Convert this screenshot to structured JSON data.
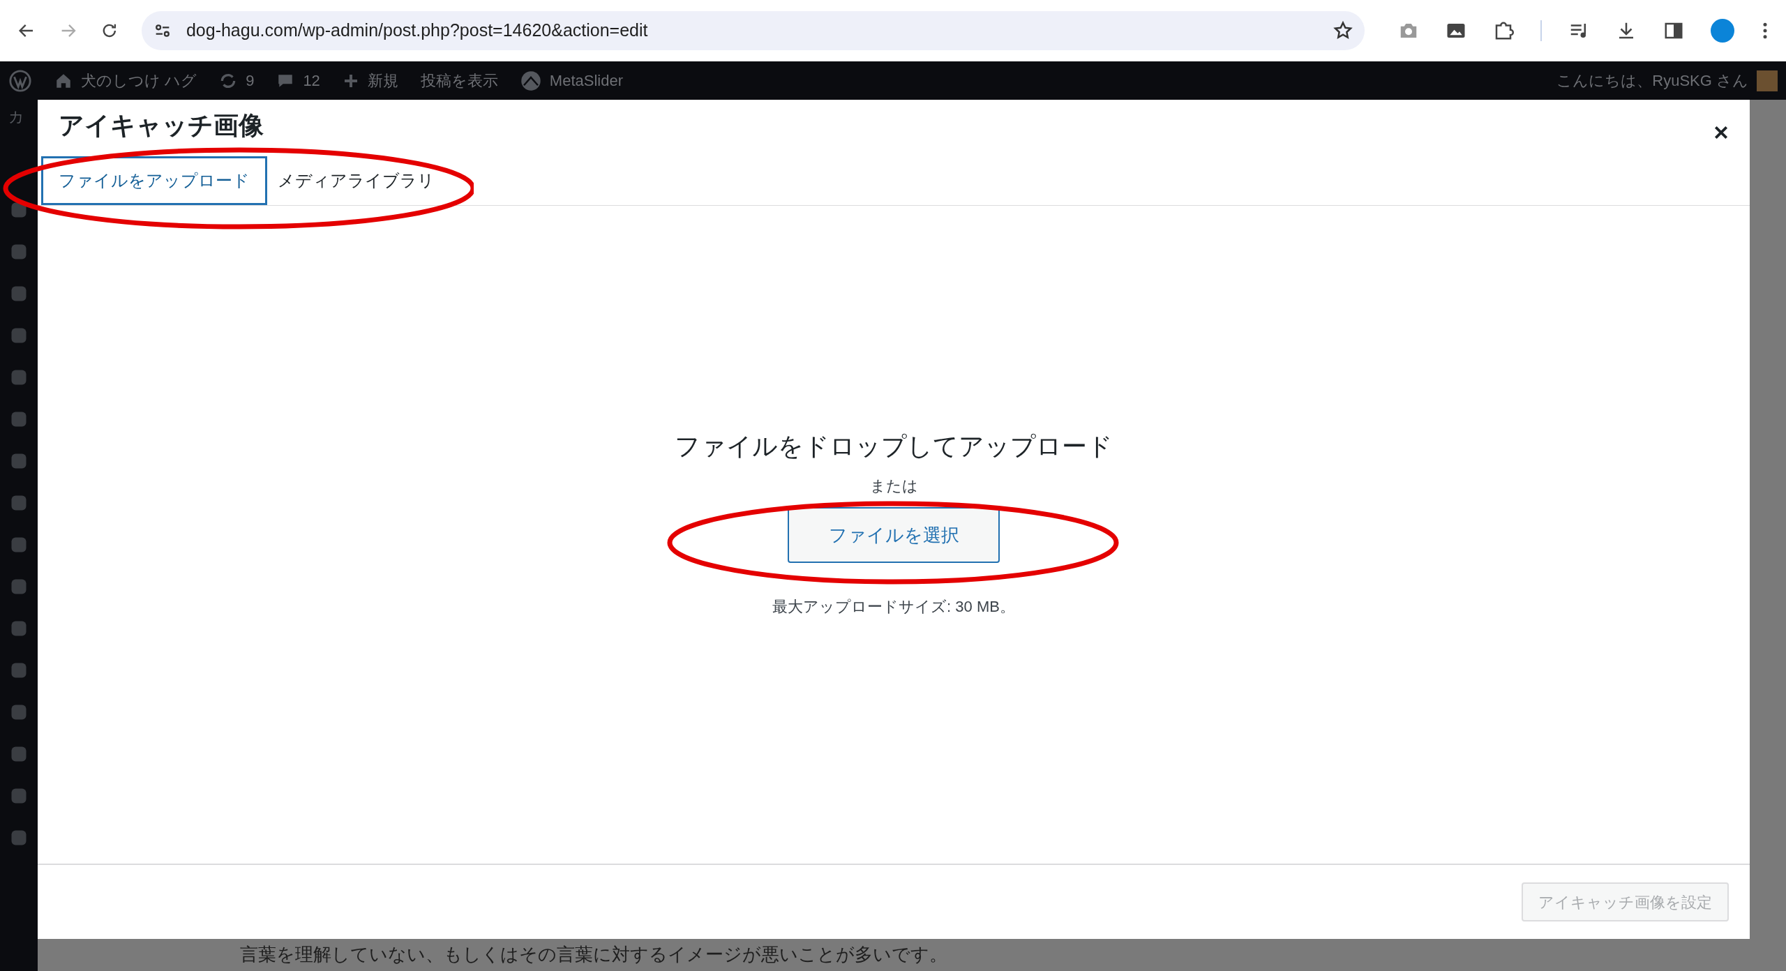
{
  "browser": {
    "url": "dog-hagu.com/wp-admin/post.php?post=14620&action=edit"
  },
  "admin_bar": {
    "site_name": "犬のしつけ ハグ",
    "updates": "9",
    "comments": "12",
    "new": "新規",
    "view_post": "投稿を表示",
    "plugin": "MetaSlider",
    "greeting": "こんにちは、RyuSKG さん"
  },
  "sidebar": {
    "partial_label": "カ"
  },
  "modal": {
    "title": "アイキャッチ画像",
    "tabs": [
      {
        "label": "ファイルをアップロード",
        "selected": true
      },
      {
        "label": "メディアライブラリ",
        "selected": false
      }
    ],
    "drop_text": "ファイルをドロップしてアップロード",
    "or_text": "または",
    "select_button": "ファイルを選択",
    "max_size": "最大アップロードサイズ: 30 MB。",
    "set_button": {
      "label": "アイキャッチ画像を設定",
      "disabled": true
    }
  },
  "background_text": "言葉を理解していない、もしくはその言葉に対するイメージが悪いことが多いです。"
}
